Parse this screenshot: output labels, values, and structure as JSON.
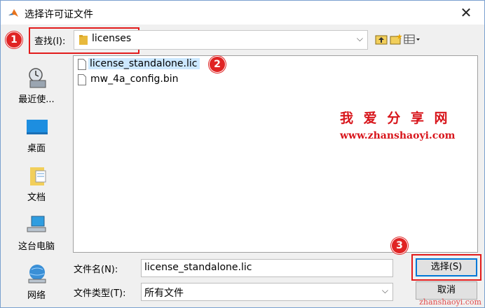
{
  "window": {
    "title": "选择许可证文件",
    "close_glyph": "✕"
  },
  "lookin": {
    "label": "查找(I):",
    "value": "licenses",
    "arrow": "⌵"
  },
  "toolbar": {
    "icons": [
      "up-folder-icon",
      "new-folder-icon",
      "view-menu-icon"
    ]
  },
  "places": [
    {
      "label": "最近使...",
      "icon": "recent-icon"
    },
    {
      "label": "桌面",
      "icon": "desktop-icon"
    },
    {
      "label": "文档",
      "icon": "documents-icon"
    },
    {
      "label": "这台电脑",
      "icon": "computer-icon"
    },
    {
      "label": "网络",
      "icon": "network-icon"
    }
  ],
  "files": [
    {
      "name": "license_standalone.lic",
      "selected": true
    },
    {
      "name": "mw_4a_config.bin",
      "selected": false
    }
  ],
  "watermark": {
    "line1": "我 爱 分 享 网",
    "line2": "www.zhanshaoyi.com",
    "corner": "zhanshaoyi.com"
  },
  "filename": {
    "label": "文件名(N):",
    "value": "license_standalone.lic"
  },
  "filetype": {
    "label": "文件类型(T):",
    "value": "所有文件",
    "arrow": "⌵"
  },
  "buttons": {
    "select": "选择(S)",
    "cancel": "取消"
  },
  "annotations": {
    "badge1": "1",
    "badge2": "2",
    "badge3": "3"
  },
  "colors": {
    "accent": "#0078d7",
    "annotation_red": "#e02424",
    "selection": "#cce8ff"
  }
}
